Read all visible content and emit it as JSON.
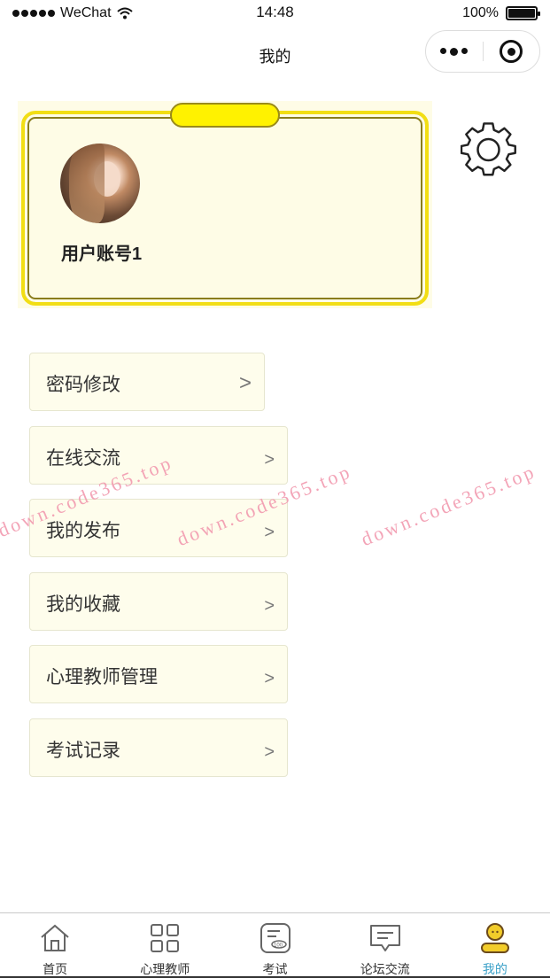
{
  "status_bar": {
    "carrier": "WeChat",
    "time": "14:48",
    "battery": "100%",
    "battery_level": 1.0
  },
  "nav": {
    "title": "我的"
  },
  "profile": {
    "username": "用户账号1"
  },
  "menu": {
    "items": [
      {
        "label": "密码修改",
        "arrow": ">"
      },
      {
        "label": "在线交流",
        "arrow": ">"
      },
      {
        "label": "我的发布",
        "arrow": ">"
      },
      {
        "label": "我的收藏",
        "arrow": ">"
      },
      {
        "label": "心理教师管理",
        "arrow": ">"
      },
      {
        "label": "考试记录",
        "arrow": ">"
      }
    ]
  },
  "watermark": {
    "text": "down.code365.top"
  },
  "tabbar": {
    "items": [
      {
        "label": "首页",
        "icon": "home-icon"
      },
      {
        "label": "心理教师",
        "icon": "grid-icon"
      },
      {
        "label": "考试",
        "icon": "exam-icon"
      },
      {
        "label": "论坛交流",
        "icon": "chat-icon"
      },
      {
        "label": "我的",
        "icon": "profile-icon",
        "active": true
      }
    ],
    "active_color": "#3aa0c8"
  },
  "colors": {
    "card_border": "#f2de14",
    "card_fill": "#fefce6",
    "menu_fill": "#fefdec",
    "watermark": "#f29bb0"
  }
}
